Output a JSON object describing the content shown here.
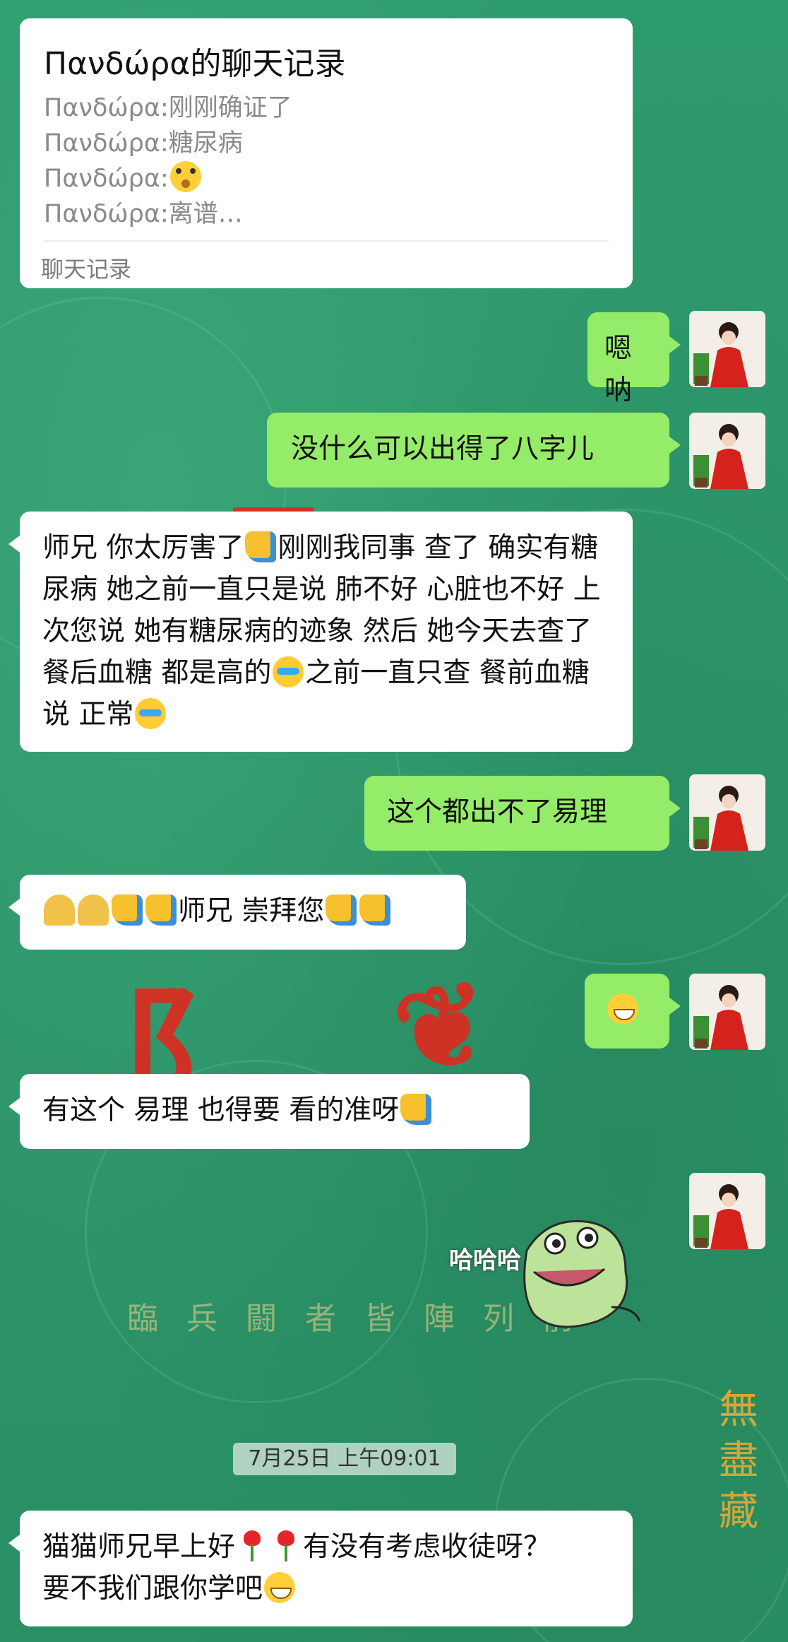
{
  "forward_card": {
    "title": "Πανδώρα的聊天记录",
    "lines": [
      "Πανδώρα:刚刚确证了",
      "Πανδώρα:糖尿病",
      "Πανδώρα:",
      "Πανδώρα:离谱…"
    ],
    "footer": "聊天记录"
  },
  "messages": [
    {
      "side": "right",
      "text": "嗯呐"
    },
    {
      "side": "right",
      "text": "没什么可以出得了八字儿"
    },
    {
      "side": "left",
      "text_parts": [
        "师兄 你太厉害了",
        "刚刚我同事  查了 确实有糖尿病 她之前一直只是说 肺不好 心脏也不好  上次您说 她有糖尿病的迹象 然后 她今天去查了 餐后血糖  都是高的",
        "之前一直只查 餐前血糖 说 正常"
      ]
    },
    {
      "side": "right",
      "text": "这个都出不了易理"
    },
    {
      "side": "left",
      "text": "师兄 崇拜您"
    },
    {
      "side": "right",
      "text": ""
    },
    {
      "side": "left",
      "text": "有这个 易理  也得要 看的准呀"
    },
    {
      "side": "right",
      "sticker_text": "哈哈哈"
    }
  ],
  "timestamp": "7月25日 上午09:01",
  "last_message": {
    "side": "left",
    "part1": "猫猫师兄早上好",
    "part2": "有没有考虑收徒呀？",
    "part3": "要不我们跟你学吧"
  },
  "background_text": {
    "strip": "臨兵闘者皆陣列前",
    "vertical": "無盡藏"
  },
  "colors": {
    "left_bubble": "#ffffff",
    "right_bubble": "#95ec69",
    "background": "#2f9a6c"
  }
}
